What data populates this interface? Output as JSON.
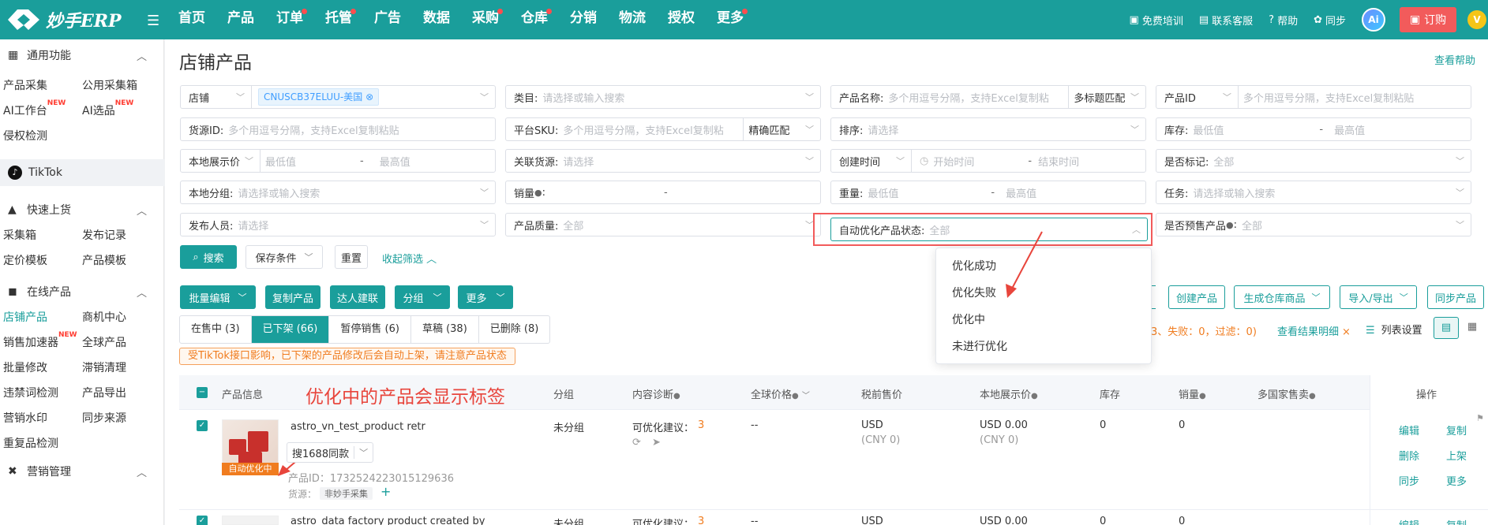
{
  "app": {
    "logo_text": "妙手ERP",
    "logo_icon": "diamond-logo-icon"
  },
  "nav": {
    "items": [
      {
        "label": "首页",
        "dot": false
      },
      {
        "label": "产品",
        "dot": false
      },
      {
        "label": "订单",
        "dot": true
      },
      {
        "label": "托管",
        "dot": true
      },
      {
        "label": "广告",
        "dot": false
      },
      {
        "label": "数据",
        "dot": false
      },
      {
        "label": "采购",
        "dot": true
      },
      {
        "label": "仓库",
        "dot": true
      },
      {
        "label": "分销",
        "dot": false
      },
      {
        "label": "物流",
        "dot": false
      },
      {
        "label": "授权",
        "dot": false
      },
      {
        "label": "更多",
        "dot": true
      }
    ],
    "training": "免费培训",
    "support": "联系客服",
    "help": "帮助",
    "sync": "同步",
    "ai": "Ai",
    "order": "订购",
    "vip": "V"
  },
  "sidebar": {
    "sections": {
      "general": "通用功能",
      "quick_publish": "快速上货",
      "online_products": "在线产品",
      "marketing": "营销管理"
    },
    "items": {
      "collect": "产品采集",
      "public_box": "公用采集箱",
      "ai_workbench": "AI工作台",
      "ai_select": "AI选品",
      "new_badge": "NEW",
      "infringement": "侵权检测",
      "tiktok": "TikTok",
      "collect_box": "采集箱",
      "publish_record": "发布记录",
      "pricing_template": "定价模板",
      "product_template": "产品模板",
      "store_products": "店铺产品",
      "merchant_center": "商机中心",
      "sales_accelerator": "销售加速器",
      "global_products": "全球产品",
      "batch_modify": "批量修改",
      "stagnant_clear": "滞销清理",
      "forbidden_words": "违禁词检测",
      "product_export": "产品导出",
      "marketing_watermark": "营销水印",
      "sync_source": "同步来源",
      "duplicate_check": "重复品检测"
    }
  },
  "page": {
    "title": "店铺产品",
    "help_link": "查看帮助"
  },
  "filters": {
    "store_label": "店铺",
    "store_tag": "CNUSCB37ELUU-美国",
    "category_label": "类目:",
    "category_ph": "请选择或输入搜索",
    "name_label": "产品名称:",
    "name_ph": "多个用逗号分隔，支持Excel复制粘",
    "name_match": "多标题匹配",
    "pid_label": "产品ID",
    "pid_ph": "多个用逗号分隔，支持Excel复制粘贴",
    "source_label": "货源ID:",
    "source_ph": "多个用逗号分隔，支持Excel复制粘贴",
    "sku_label": "平台SKU:",
    "sku_ph": "多个用逗号分隔，支持Excel复制粘",
    "sku_match": "精确匹配",
    "sort_label": "排序:",
    "sort_ph": "请选择",
    "stock_label": "库存:",
    "min_ph": "最低值",
    "max_ph": "最高值",
    "local_price_label": "本地展示价",
    "related_label": "关联货源:",
    "related_ph": "请选择",
    "create_time_label": "创建时间",
    "start_ph": "开始时间",
    "end_ph": "结束时间",
    "marked_label": "是否标记:",
    "all": "全部",
    "local_group_label": "本地分组:",
    "local_group_ph": "请选择或输入搜索",
    "sales_label": "销量",
    "weight_label": "重量:",
    "task_label": "任务:",
    "task_ph": "请选择或输入搜索",
    "publisher_label": "发布人员:",
    "publisher_ph": "请选择",
    "quality_label": "产品质量:",
    "auto_opt_label": "自动优化产品状态:",
    "presale_label": "是否预售产品",
    "dash": "-"
  },
  "actions": {
    "search": "搜索",
    "save_cond": "保存条件",
    "reset": "重置",
    "collapse": "收起筛选",
    "batch_edit": "批量编辑",
    "copy_product": "复制产品",
    "influencer": "达人建联",
    "group": "分组",
    "more": "更多",
    "create_product": "创建产品",
    "gen_warehouse": "生成仓库商品",
    "import_export": "导入/导出",
    "sync_product": "同步产品",
    "result_text": "3、失败：0，过滤：0)",
    "result_link": "查看结果明细",
    "col_settings": "列表设置"
  },
  "dropdown": {
    "options": [
      "优化成功",
      "优化失败",
      "优化中",
      "未进行优化"
    ]
  },
  "tabs": [
    {
      "label": "在售中 (3)",
      "active": false
    },
    {
      "label": "已下架 (66)",
      "active": true
    },
    {
      "label": "暂停销售 (6)",
      "active": false
    },
    {
      "label": "草稿 (38)",
      "active": false
    },
    {
      "label": "已删除 (8)",
      "active": false
    }
  ],
  "notice": "受TikTok接口影响，已下架的产品修改后会自动上架，请注意产品状态",
  "annotation": "优化中的产品会显示标签",
  "table": {
    "headers": {
      "info": "产品信息",
      "group": "分组",
      "diagnosis": "内容诊断",
      "global_price": "全球价格",
      "tax_price": "税前售价",
      "local_price": "本地展示价",
      "stock": "库存",
      "sales": "销量",
      "multi_country": "多国家售卖",
      "ops": "操作"
    },
    "rows": [
      {
        "title": "astro_vn_test_product retr",
        "search_1688": "搜1688同款",
        "auto_tag": "自动优化中",
        "pid": "产品ID：1732524223015129636",
        "source_label": "货源：",
        "source_tag": "非妙手采集",
        "group": "未分组",
        "diag_label": "可优化建议：",
        "diag_count": "3",
        "global_price": "--",
        "tax_currency": "USD",
        "tax_cny": "(CNY 0)",
        "local_price": "USD 0.00",
        "local_cny": "(CNY 0)",
        "stock": "0",
        "sales": "0",
        "ops": [
          "编辑",
          "复制",
          "删除",
          "上架",
          "同步",
          "更多"
        ]
      },
      {
        "title": "astro_data factory product created by",
        "group": "未分组",
        "diag_label": "可优化建议：",
        "diag_count": "3",
        "global_price": "--",
        "tax_currency": "USD",
        "local_price": "USD 0.00",
        "stock": "0",
        "sales": "0",
        "ops": [
          "编辑",
          "复制"
        ]
      }
    ]
  },
  "colors": {
    "accent": "#1a9e9b",
    "danger": "#f25b5b",
    "warn": "#f07c1f"
  }
}
